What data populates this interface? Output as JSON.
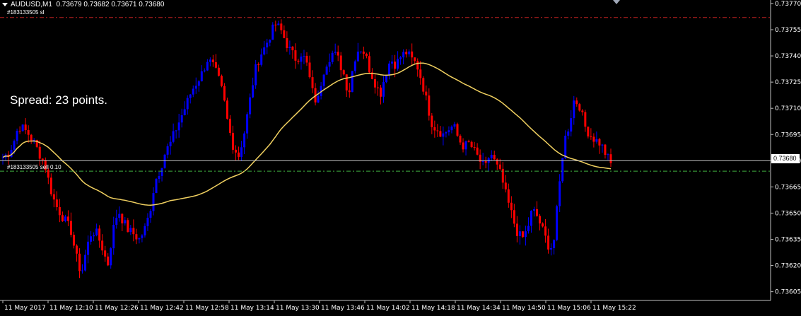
{
  "header": {
    "symbol": "AUDUSD,M1",
    "ohlc": "0.73679 0.73682 0.73671 0.73680"
  },
  "sl_label": "#183133505 sl",
  "order_label": "#183133505 sell 0.10",
  "spread_label": "Spread: 23 points.",
  "current_price": "0.73680",
  "colors": {
    "background": "#000000",
    "bull": "#0000ff",
    "bear": "#ff0000",
    "ma": "#f0d060",
    "sl_line": "#c02020",
    "order_line": "#40b040",
    "axis": "#c0c0c0"
  },
  "chart_data": {
    "type": "candlestick",
    "y_ticks": [
      "0.73770",
      "0.73755",
      "0.73740",
      "0.73725",
      "0.73710",
      "0.73695",
      "0.73680",
      "0.73665",
      "0.73650",
      "0.73635",
      "0.73620",
      "0.73605"
    ],
    "x_ticks": [
      "11 May 2017",
      "11 May 12:10",
      "11 May 12:26",
      "11 May 12:42",
      "11 May 12:58",
      "11 May 13:14",
      "11 May 13:30",
      "11 May 13:46",
      "11 May 14:02",
      "11 May 14:18",
      "11 May 14:34",
      "11 May 14:50",
      "11 May 15:06",
      "11 May 15:22"
    ],
    "ylim": [
      0.736,
      0.73772
    ],
    "sl_price": 0.73762,
    "order_price": 0.73674,
    "current_price": 0.7368,
    "close_path": [
      0.73682,
      0.73684,
      0.7369,
      0.737,
      0.73698,
      0.73695,
      0.7369,
      0.73684,
      0.73678,
      0.73665,
      0.73655,
      0.7365,
      0.73645,
      0.7364,
      0.73625,
      0.73615,
      0.7363,
      0.7364,
      0.73638,
      0.7363,
      0.7362,
      0.7364,
      0.73652,
      0.73645,
      0.7364,
      0.73638,
      0.73635,
      0.7364,
      0.7365,
      0.73668,
      0.73675,
      0.73685,
      0.7369,
      0.73698,
      0.73705,
      0.73712,
      0.7372,
      0.73725,
      0.7373,
      0.73738,
      0.73735,
      0.73728,
      0.73718,
      0.737,
      0.73688,
      0.73683,
      0.73695,
      0.73712,
      0.7373,
      0.7374,
      0.73745,
      0.73752,
      0.73758,
      0.73755,
      0.73748,
      0.73742,
      0.73738,
      0.73742,
      0.73735,
      0.7372,
      0.73712,
      0.7373,
      0.73738,
      0.73742,
      0.73738,
      0.7373,
      0.73718,
      0.73738,
      0.73745,
      0.73742,
      0.73732,
      0.73725,
      0.73718,
      0.7373,
      0.73738,
      0.73735,
      0.7374,
      0.73742,
      0.73738,
      0.73735,
      0.73725,
      0.73712,
      0.737,
      0.73698,
      0.73695,
      0.73698,
      0.737,
      0.73692,
      0.73688,
      0.7369,
      0.73685,
      0.7368,
      0.73675,
      0.73685,
      0.73678,
      0.73672,
      0.7366,
      0.7365,
      0.7364,
      0.73635,
      0.7364,
      0.73652,
      0.73648,
      0.7364,
      0.73632,
      0.7363,
      0.7366,
      0.7369,
      0.737,
      0.73715,
      0.73712,
      0.737,
      0.73695,
      0.73692,
      0.7369,
      0.73684,
      0.73678
    ]
  }
}
